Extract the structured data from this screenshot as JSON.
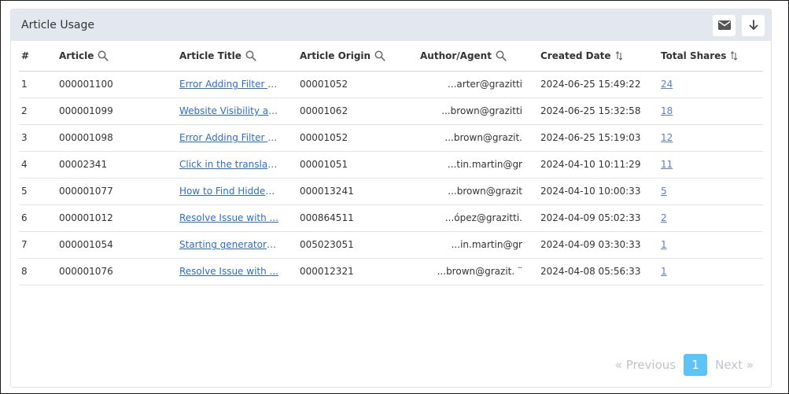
{
  "card": {
    "title": "Article Usage",
    "icons": {
      "email": "mail-icon",
      "download": "download-icon"
    }
  },
  "columns": [
    {
      "label": "#",
      "icon": ""
    },
    {
      "label": "Article",
      "icon": "search-icon"
    },
    {
      "label": "Article Title",
      "icon": "search-icon"
    },
    {
      "label": "Article Origin",
      "icon": "search-icon"
    },
    {
      "label": "Author/Agent",
      "icon": "search-icon"
    },
    {
      "label": "Created Date",
      "icon": "sort-icon"
    },
    {
      "label": "Total Shares",
      "icon": "sort-icon"
    }
  ],
  "rows": [
    {
      "num": "1",
      "article": "000001100",
      "title": "Error Adding Filter i...",
      "origin": "00001052",
      "author": "arter@grazitti...",
      "created": "2024-06-25 15:49:22",
      "shares": "24"
    },
    {
      "num": "2",
      "article": "000001099",
      "title": "Website Visibility an...",
      "origin": "00001062",
      "author": "brown@grazitti...",
      "created": "2024-06-25 15:32:58",
      "shares": "18"
    },
    {
      "num": "3",
      "article": "000001098",
      "title": "Error Adding Filter i...",
      "origin": "00001052",
      "author": ".brown@grazit...",
      "created": "2024-06-25 15:19:03",
      "shares": "12"
    },
    {
      "num": "4",
      "article": "00002341",
      "title": "Click in the translati...",
      "origin": "00001051",
      "author": "tin.martin@gr...",
      "created": "2024-04-10 10:11:29",
      "shares": "11"
    },
    {
      "num": "5",
      "article": "000001077",
      "title": "How to Find Hidden...",
      "origin": "000013241",
      "author": "brown@grazit...",
      "created": "2024-04-10 10:00:33",
      "shares": "5"
    },
    {
      "num": "6",
      "article": "000001012",
      "title": "Resolve Issue with ...",
      "origin": "000864511",
      "author": ".ópez@grazitti...",
      "created": "2024-04-09 05:02:33",
      "shares": "2"
    },
    {
      "num": "7",
      "article": "000001054",
      "title": "Starting generator a...",
      "origin": "005023051",
      "author": "in.martin@gr...",
      "created": "2024-04-09 03:30:33",
      "shares": "1"
    },
    {
      "num": "8",
      "article": "000001076",
      "title": "Resolve Issue with ...",
      "origin": "000012321",
      "author": "¨ .brown@grazit...",
      "created": "2024-04-08 05:56:33",
      "shares": "1"
    }
  ],
  "pagination": {
    "previous": "« Previous",
    "current": "1",
    "next": "Next »"
  }
}
